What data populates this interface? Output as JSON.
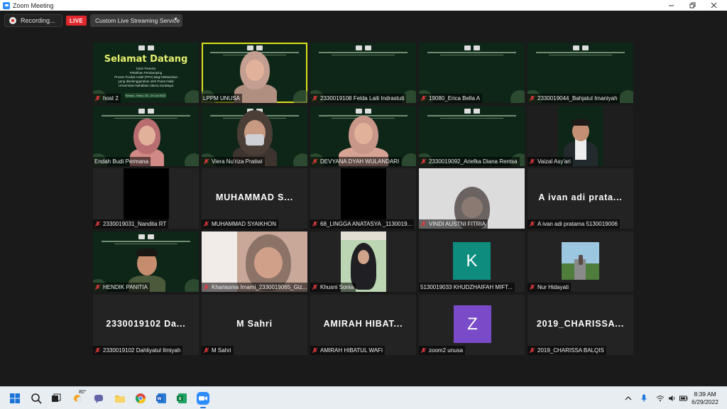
{
  "window": {
    "title": "Zoom Meeting"
  },
  "toolbar": {
    "recording_label": "Recording...",
    "live_badge": "LIVE",
    "stream_service_label": "Custom Live Streaming Service"
  },
  "welcome_slide": {
    "title": "Selamat Datang",
    "line1": "Kami Peserta",
    "line2": "Pelatihan Pendamping",
    "line3": "Proses Produk Halal (PPH) Bagi Mahasiswa",
    "line4": "yang diselenggarakan oleh Pusat Halal",
    "line5": "Universitas Nahdlatul Ulama Surabaya",
    "date": "Selasa - Rabu, 28 - 29 Juli 2022"
  },
  "participants": [
    {
      "name": "host 2"
    },
    {
      "name": "LPPM UNUSA"
    },
    {
      "name": "2330019108 Felda Laili Indrastuti"
    },
    {
      "name": "19080_Erica Bella A"
    },
    {
      "name": "2330019044_Bahjatul Imaniyah"
    },
    {
      "name": "Endah Budi Permana"
    },
    {
      "name": "Viera Nu'riza Pratiwi"
    },
    {
      "name": "DEVYANA DYAH WULANDARI"
    },
    {
      "name": "2330019092_Ariefka Diana Rentsa"
    },
    {
      "name": "Vaizal Asy'ari"
    },
    {
      "name": "2330019031_Nandita RT"
    },
    {
      "name": "MUHAMMAD SYAIKHON",
      "display": "MUHAMMAD  S..."
    },
    {
      "name": "68_LINGGA ANATASYA _1130019..."
    },
    {
      "name": "VINDI AUSTNI FITRIA"
    },
    {
      "name": "A ivan adi pratama 5130019006",
      "display": "A ivan adi prata..."
    },
    {
      "name": "HENDIK PANITIA"
    },
    {
      "name": "Khariasma Imami_2330019065_Giz..."
    },
    {
      "name": "Khusni Sonia"
    },
    {
      "name": "5130019033 KHUDZHAIFAH MIFT...",
      "avatar": "K"
    },
    {
      "name": "Nur Hidayati"
    },
    {
      "name": "2330019102 Dahliyatul Ilmiyah",
      "display": "2330019102  Da..."
    },
    {
      "name": "M Sahri",
      "display": "M Sahri"
    },
    {
      "name": "AMIRAH HIBATUL WAFI",
      "display": "AMIRAH  HIBAT..."
    },
    {
      "name": "zoom2 unusa",
      "avatar": "Z"
    },
    {
      "name": "2019_CHARISSA BALQIS",
      "display": "2019_CHARISSA..."
    }
  ],
  "taskbar": {
    "weather_temp": "80°",
    "time": "8:39 AM",
    "date": "6/29/2022"
  },
  "colors": {
    "accent_active": "#d9e21d",
    "live_red": "#e0282e",
    "avatar_k": "#0e8c7e",
    "avatar_z": "#7a4bc9",
    "slide_green": "#0d2617"
  }
}
